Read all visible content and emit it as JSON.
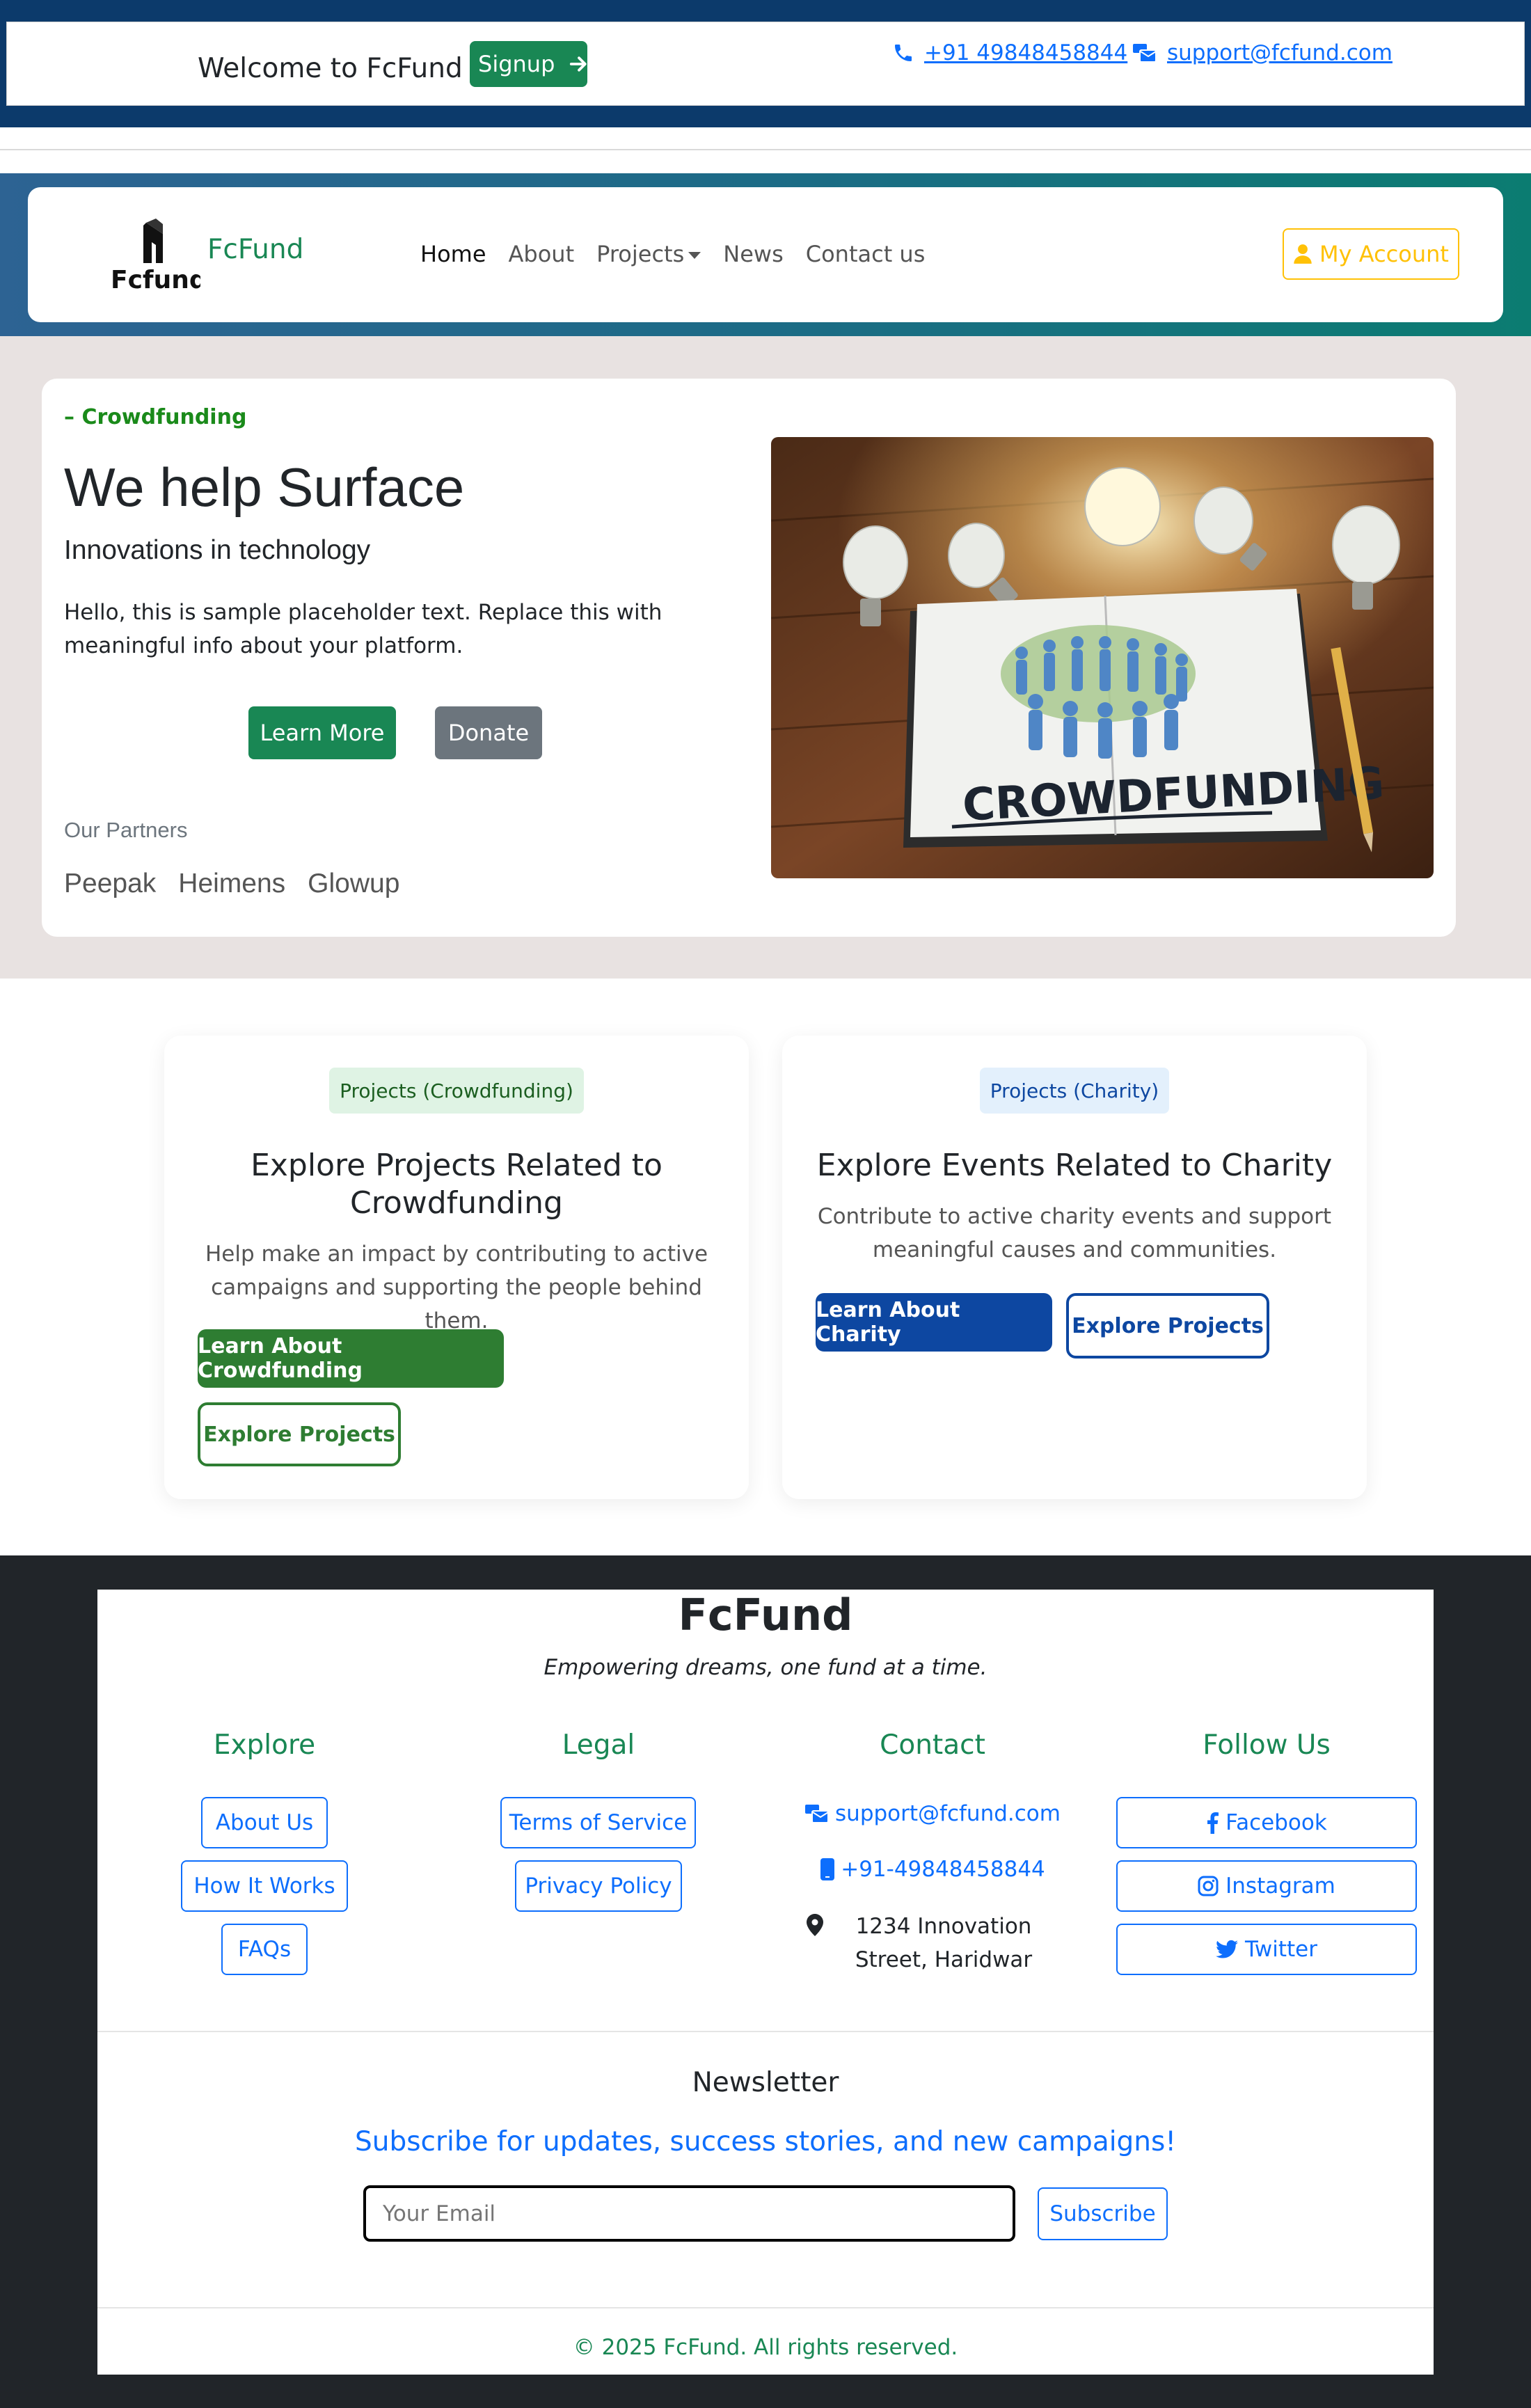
{
  "topbar": {
    "welcome": "Welcome to FcFund",
    "signup_label": "Signup",
    "phone": " +91 49848458844",
    "email": " support@fcfund.com"
  },
  "navbar": {
    "logo_text": "Fcfund",
    "brand": "FcFund",
    "links": [
      "Home",
      "About",
      "Projects",
      "News",
      "Contact us"
    ],
    "account_label": "My Account"
  },
  "hero": {
    "eyebrow": "– Crowdfunding",
    "title": "We help Surface",
    "subtitle": "Innovations in technology",
    "text": "Hello, this is sample placeholder text. Replace this with meaningful info about your platform.",
    "learn_more": "Learn More",
    "donate": "Donate",
    "partners_label": "Our Partners",
    "partners": [
      "Peepak",
      "Heimens",
      "Glowup"
    ],
    "image_text": "CROWDFUNDING"
  },
  "cards": [
    {
      "badge": "Projects (Crowdfunding)",
      "title": "Explore Projects Related to Crowdfunding",
      "text": "Help make an impact by contributing to active campaigns and supporting the people behind them.",
      "primary": "Learn About Crowdfunding",
      "secondary": "Explore Projects"
    },
    {
      "badge": "Projects (Charity)",
      "title": "Explore Events Related to Charity",
      "text": "Contribute to active charity events and support meaningful causes and communities.",
      "primary": "Learn About Charity",
      "secondary": "Explore Projects"
    }
  ],
  "footer": {
    "title": "FcFund",
    "tagline": "Empowering dreams, one fund at a time.",
    "explore": {
      "heading": "Explore",
      "links": [
        "About Us",
        "How It Works",
        "FAQs"
      ]
    },
    "legal": {
      "heading": "Legal",
      "links": [
        "Terms of Service",
        "Privacy Policy"
      ]
    },
    "contact": {
      "heading": "Contact",
      "email": "support@fcfund.com",
      "phone": "+91-49848458844",
      "address": "1234 Innovation Street, Haridwar"
    },
    "follow": {
      "heading": "Follow Us",
      "links": [
        "Facebook",
        "Instagram",
        "Twitter"
      ]
    },
    "newsletter": {
      "title": "Newsletter",
      "subtitle": "Subscribe for updates, success stories, and new campaigns!",
      "placeholder": "Your Email",
      "button": "Subscribe"
    },
    "copyright": "© 2025 FcFund. All rights reserved."
  },
  "colors": {
    "primary_green": "#198754",
    "primary_blue": "#0d6efd",
    "charity_blue": "#0d47a1",
    "crowd_green": "#2e7d32",
    "warning": "#ffc107",
    "dark": "#212529"
  }
}
